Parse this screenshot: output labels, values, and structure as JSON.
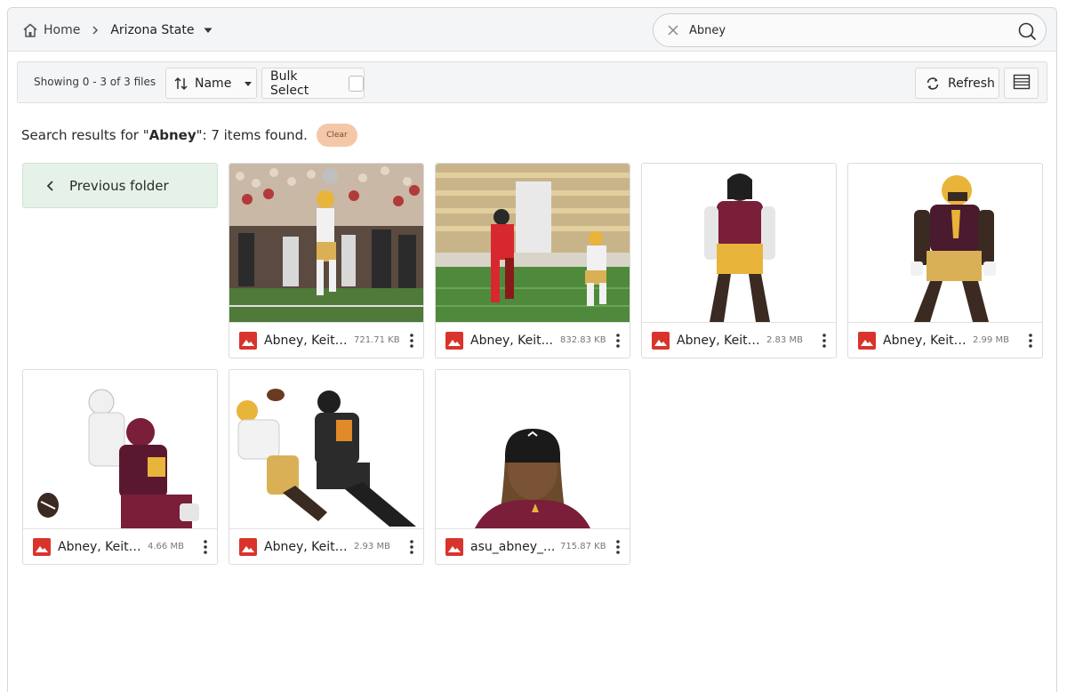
{
  "breadcrumb": {
    "home": "Home",
    "current": "Arizona State"
  },
  "search": {
    "value": "Abney",
    "placeholder": ""
  },
  "toolbar": {
    "count": "Showing 0 - 3 of 3 files",
    "sort_label": "Name",
    "bulk_label": "Bulk Select",
    "refresh_label": "Refresh"
  },
  "results": {
    "prefix": "Search results for \"",
    "query": "Abney",
    "suffix": "\": 7 items found.",
    "clear_label": "Clear"
  },
  "prev_folder": "Previous folder",
  "files": [
    {
      "name": "Abney, Keith...",
      "size": "721.71 KB"
    },
    {
      "name": "Abney, Keit...",
      "size": "832.83 KB"
    },
    {
      "name": "Abney, Keith-...",
      "size": "2.83 MB"
    },
    {
      "name": "Abney, Keith-...",
      "size": "2.99 MB"
    },
    {
      "name": "Abney, Keith-...",
      "size": "4.66 MB"
    },
    {
      "name": "Abney, Keith-...",
      "size": "2.93 MB"
    },
    {
      "name": "asu_abney_...",
      "size": "715.87 KB"
    }
  ],
  "colors": {
    "accent_green": "#e6f2e8",
    "clear_pill": "#f4c7a8",
    "image_icon": "#d9342b",
    "asu_maroon": "#7a1e3a",
    "asu_gold": "#e8b43a"
  }
}
